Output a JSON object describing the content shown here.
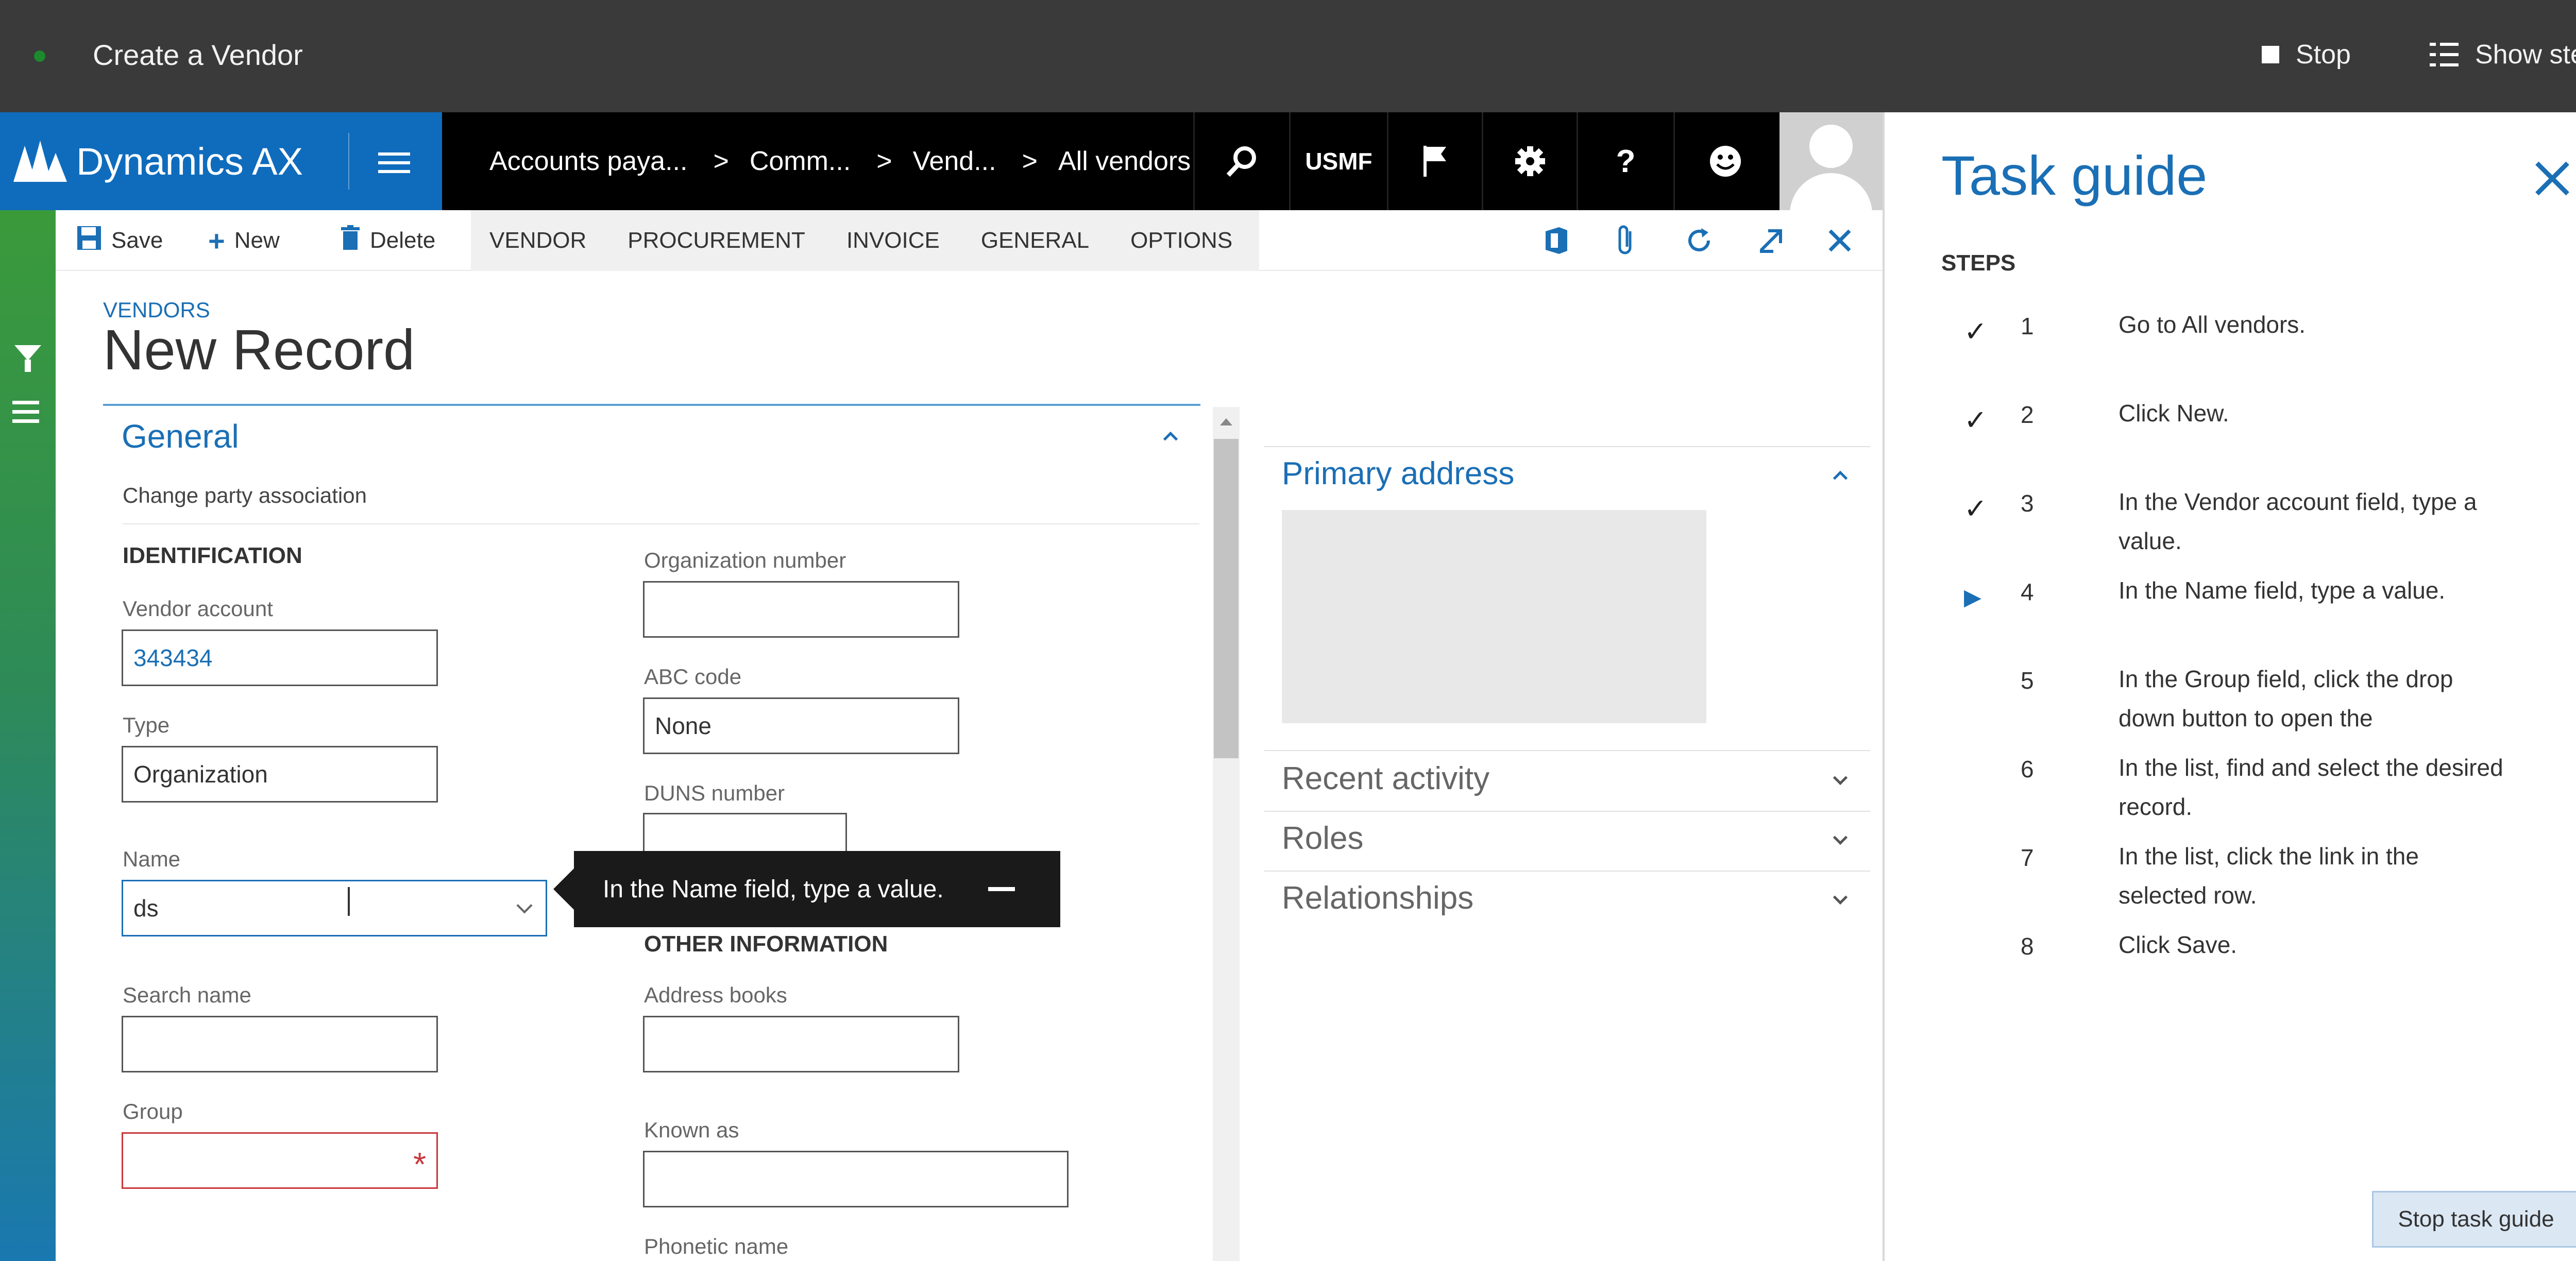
{
  "recorder": {
    "title": "Create a Vendor",
    "stop_label": "Stop",
    "show_steps_label": "Show steps"
  },
  "navbar": {
    "brand": "Dynamics AX",
    "breadcrumbs": [
      "Accounts paya...",
      "Comm...",
      "Vend...",
      "All vendors"
    ],
    "company": "USMF"
  },
  "actionbar": {
    "save": "Save",
    "new": "New",
    "delete": "Delete",
    "menus": [
      "VENDOR",
      "PROCUREMENT",
      "INVOICE",
      "GENERAL",
      "OPTIONS"
    ]
  },
  "page": {
    "breadcrumb": "VENDORS",
    "title": "New Record"
  },
  "general": {
    "title": "General",
    "change_party": "Change party association",
    "identification_heading": "IDENTIFICATION",
    "other_info_heading": "OTHER INFORMATION",
    "vendor_account": {
      "label": "Vendor account",
      "value": "343434"
    },
    "type": {
      "label": "Type",
      "value": "Organization"
    },
    "name": {
      "label": "Name",
      "value": "ds"
    },
    "search_name": {
      "label": "Search name",
      "value": ""
    },
    "group": {
      "label": "Group",
      "value": ""
    },
    "organization_number": {
      "label": "Organization number",
      "value": ""
    },
    "abc_code": {
      "label": "ABC code",
      "value": "None"
    },
    "duns_number": {
      "label": "DUNS number",
      "value": ""
    },
    "address_books": {
      "label": "Address books",
      "value": ""
    },
    "known_as": {
      "label": "Known as",
      "value": ""
    },
    "phonetic_name": {
      "label": "Phonetic name"
    }
  },
  "callout": {
    "text": "In the Name field, type a value."
  },
  "fact_panes": {
    "primary_address": "Primary address",
    "recent_activity": "Recent activity",
    "roles": "Roles",
    "relationships": "Relationships"
  },
  "task_guide": {
    "title": "Task guide",
    "steps_heading": "STEPS",
    "steps": [
      {
        "num": "1",
        "text": "Go to All vendors.",
        "status": "done"
      },
      {
        "num": "2",
        "text": "Click New.",
        "status": "done"
      },
      {
        "num": "3",
        "text": "In the Vendor account field, type a value.",
        "status": "done"
      },
      {
        "num": "4",
        "text": "In the Name field, type a value.",
        "status": "current"
      },
      {
        "num": "5",
        "text": "In the Group field, click the drop down button to open the",
        "status": "pending"
      },
      {
        "num": "6",
        "text": "In the list, find and select the desired record.",
        "status": "pending"
      },
      {
        "num": "7",
        "text": "In the list, click the link in the selected row.",
        "status": "pending"
      },
      {
        "num": "8",
        "text": "Click Save.",
        "status": "pending"
      }
    ],
    "stop_button": "Stop task guide"
  },
  "colors": {
    "accent": "#1a6fb5",
    "brand_blue": "#0f6cbd",
    "required": "#c8373b",
    "recorder_bg": "#3a3a3a"
  }
}
